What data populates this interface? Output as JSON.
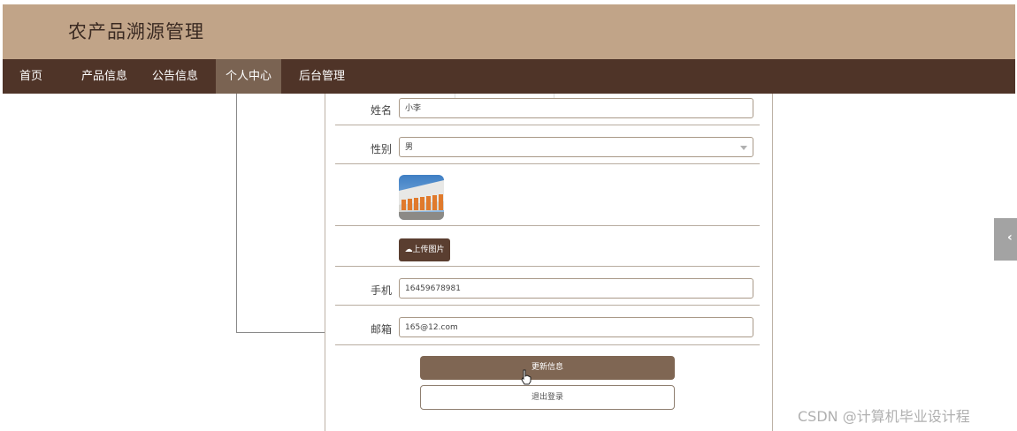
{
  "header": {
    "title": "农产品溯源管理"
  },
  "nav": {
    "items": [
      {
        "label": "首页"
      },
      {
        "label": "产品信息"
      },
      {
        "label": "公告信息"
      },
      {
        "label": "个人中心"
      },
      {
        "label": "后台管理"
      }
    ],
    "active": "个人中心"
  },
  "form": {
    "name": {
      "label": "姓名",
      "value": "小李"
    },
    "gender": {
      "label": "性别",
      "value": "男"
    },
    "upload_label": "上传图片",
    "phone": {
      "label": "手机",
      "value": "16459678981"
    },
    "email": {
      "label": "邮箱",
      "value": "165@12.com"
    },
    "update_label": "更新信息",
    "logout_label": "退出登录"
  },
  "watermark": "CSDN @计算机毕业设计程",
  "icons": {
    "upload": "cloud-upload-icon",
    "side_toggle": "chevron-left-icon",
    "cursor": "hand-pointer-icon"
  },
  "colors": {
    "header_bg": "#c1a488",
    "nav_bg": "#4f3428",
    "nav_active": "#7a6352",
    "button_primary": "#7f6653"
  }
}
